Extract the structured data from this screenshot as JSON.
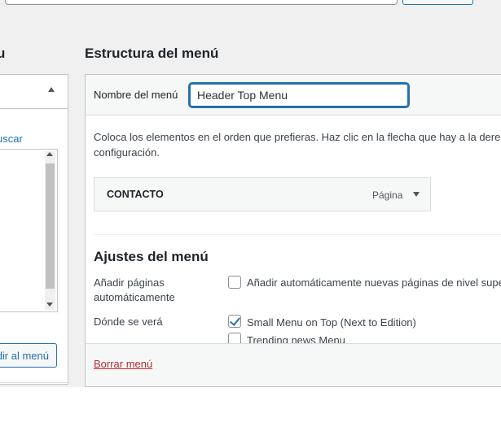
{
  "left": {
    "heading": "u",
    "search_link": "uscar",
    "add_button": "dir al menú"
  },
  "structure": {
    "heading": "Estructura del menú",
    "name_label": "Nombre del menú",
    "name_value": "Header Top Menu",
    "instructions_line1": "Coloca los elementos en el orden que prefieras. Haz clic en la flecha que hay a la derech",
    "instructions_line2": "configuración.",
    "items": [
      {
        "title": "CONTACTO",
        "type": "Página"
      }
    ]
  },
  "settings": {
    "heading": "Ajustes del menú",
    "auto_add_label": "Añadir páginas automáticamente",
    "auto_add_option": "Añadir automáticamente nuevas páginas de nivel supe",
    "auto_add_checked": false,
    "display_label": "Dónde se verá",
    "locations": [
      {
        "label": "Small Menu on Top (Next to Edition)",
        "checked": true
      },
      {
        "label": "Trending news Menu",
        "checked": false
      }
    ]
  },
  "footer": {
    "delete_link": "Borrar menú"
  },
  "colors": {
    "accent": "#2271b1",
    "danger": "#b32d2e",
    "background": "#f0f0f1"
  }
}
